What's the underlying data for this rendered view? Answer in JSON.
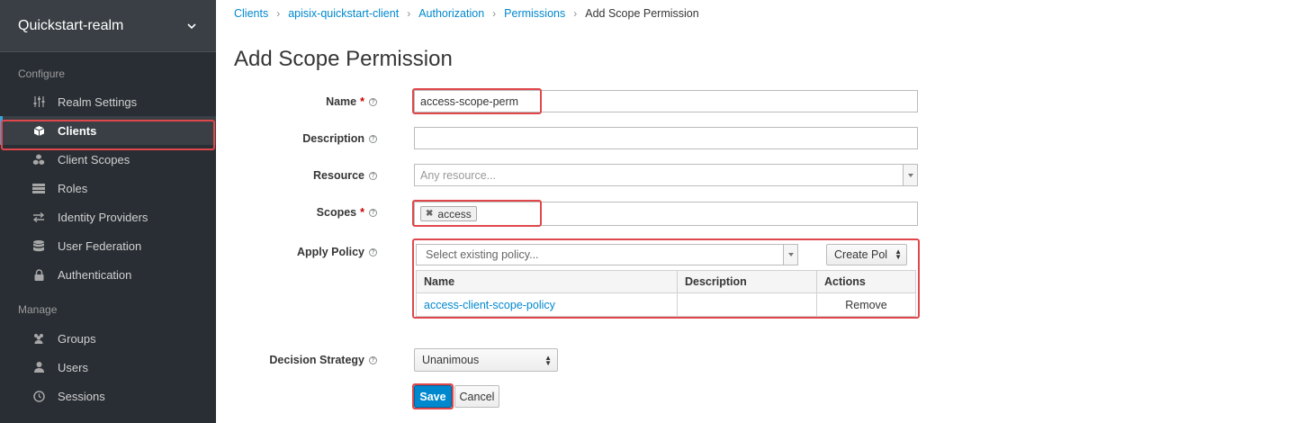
{
  "sidebar": {
    "realm": "Quickstart-realm",
    "configure_label": "Configure",
    "manage_label": "Manage",
    "configure_items": [
      {
        "label": "Realm Settings",
        "icon": "sliders-icon"
      },
      {
        "label": "Clients",
        "icon": "cube-icon",
        "active": true
      },
      {
        "label": "Client Scopes",
        "icon": "cubes-icon"
      },
      {
        "label": "Roles",
        "icon": "list-icon"
      },
      {
        "label": "Identity Providers",
        "icon": "exchange-icon"
      },
      {
        "label": "User Federation",
        "icon": "database-icon"
      },
      {
        "label": "Authentication",
        "icon": "lock-icon"
      }
    ],
    "manage_items": [
      {
        "label": "Groups",
        "icon": "users-icon"
      },
      {
        "label": "Users",
        "icon": "user-icon"
      },
      {
        "label": "Sessions",
        "icon": "clock-icon"
      }
    ]
  },
  "breadcrumb": [
    "Clients",
    "apisix-quickstart-client",
    "Authorization",
    "Permissions",
    "Add Scope Permission"
  ],
  "page_title": "Add Scope Permission",
  "form": {
    "name_label": "Name",
    "name_value": "access-scope-perm",
    "description_label": "Description",
    "description_value": "",
    "resource_label": "Resource",
    "resource_placeholder": "Any resource...",
    "scopes_label": "Scopes",
    "scopes_tags": [
      "access"
    ],
    "apply_policy_label": "Apply Policy",
    "policy_placeholder": "Select existing policy...",
    "create_policy_label": "Create Pol",
    "policy_table": {
      "headers": [
        "Name",
        "Description",
        "Actions"
      ],
      "rows": [
        {
          "name": "access-client-scope-policy",
          "description": "",
          "action": "Remove"
        }
      ]
    },
    "decision_label": "Decision Strategy",
    "decision_value": "Unanimous",
    "required_mark": "*",
    "help_glyph": "?"
  },
  "buttons": {
    "save": "Save",
    "cancel": "Cancel"
  },
  "colors": {
    "sidebar_bg": "#292e34",
    "link": "#0088ce",
    "primary": "#0088ce",
    "highlight": "#e0474b"
  }
}
